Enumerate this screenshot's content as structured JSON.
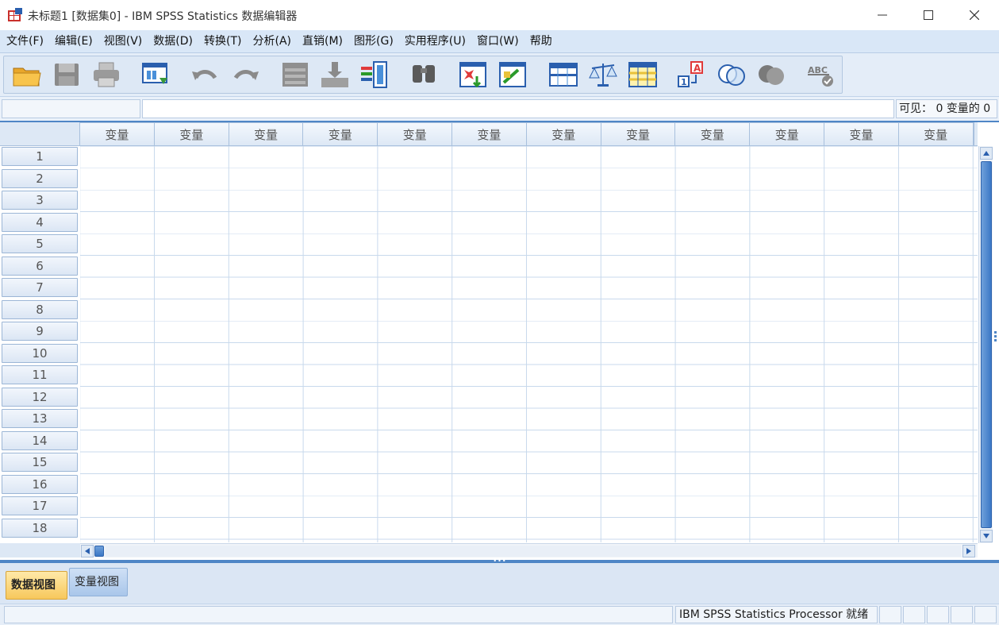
{
  "window": {
    "title": "未标题1 [数据集0] - IBM SPSS Statistics 数据编辑器"
  },
  "menu": [
    "文件(F)",
    "编辑(E)",
    "视图(V)",
    "数据(D)",
    "转换(T)",
    "分析(A)",
    "直销(M)",
    "图形(G)",
    "实用程序(U)",
    "窗口(W)",
    "帮助"
  ],
  "toolbar": {
    "icons": [
      "open-folder-icon",
      "save-icon",
      "print-icon",
      "recall-dialog-icon",
      "undo-icon",
      "redo-icon",
      "goto-case-icon",
      "goto-variable-icon",
      "variables-icon",
      "find-icon",
      "insert-cases-icon",
      "insert-variable-icon",
      "split-file-icon",
      "weight-cases-icon",
      "select-cases-icon",
      "value-labels-icon",
      "use-sets-icon",
      "show-all-variables-icon",
      "spell-check-icon"
    ]
  },
  "editor": {
    "cell_ref": "",
    "cell_value": "",
    "visible_label": "可见： 0 变量的 0"
  },
  "grid": {
    "column_headers": [
      "变量",
      "变量",
      "变量",
      "变量",
      "变量",
      "变量",
      "变量",
      "变量",
      "变量",
      "变量",
      "变量",
      "变量"
    ],
    "row_numbers": [
      "1",
      "2",
      "3",
      "4",
      "5",
      "6",
      "7",
      "8",
      "9",
      "10",
      "11",
      "12",
      "13",
      "14",
      "15",
      "16",
      "17",
      "18"
    ]
  },
  "tabs": {
    "data_view": "数据视图",
    "variable_view": "变量视图"
  },
  "status": {
    "processor": "IBM SPSS Statistics Processor 就绪"
  },
  "colors": {
    "accent": "#4f86c6",
    "menubar": "#d9e7f7",
    "active_tab": "#f7c85c"
  }
}
